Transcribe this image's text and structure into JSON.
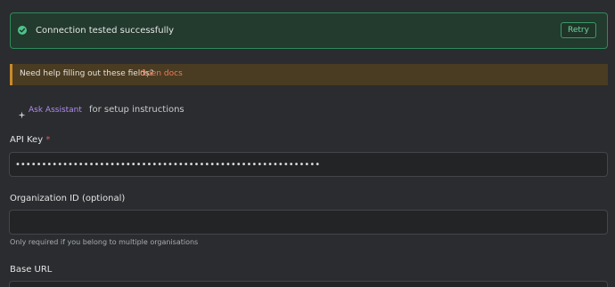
{
  "success_banner": {
    "message": "Connection tested successfully",
    "retry_label": "Retry",
    "status_color": "#4cc38a"
  },
  "help_banner": {
    "text": "Need help filling out these fields?",
    "link_text": "Open docs",
    "accent_color": "#c98a2b"
  },
  "assistant": {
    "button_label": "Ask Assistant",
    "icon": "sparkle-icon",
    "suffix_text": "for setup instructions"
  },
  "fields": {
    "api_key": {
      "label": "API Key",
      "required_marker": "*",
      "value": "••••••••••••••••••••••••••••••••••••••••••••••••••••••••••"
    },
    "organization_id": {
      "label": "Organization ID (optional)",
      "value": "",
      "hint": "Only required if you belong to multiple organisations"
    },
    "base_url": {
      "label": "Base URL",
      "value": ""
    }
  }
}
